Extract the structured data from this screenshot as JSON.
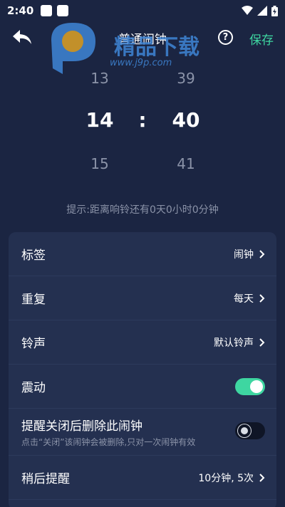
{
  "status_bar": {
    "time": "2:40"
  },
  "header": {
    "title": "普通闹钟",
    "help_label": "?",
    "save_label": "保存"
  },
  "watermark": {
    "text": "精品下载",
    "url": "www.j9p.com"
  },
  "picker": {
    "hours": [
      "13",
      "14",
      "15"
    ],
    "minutes": [
      "39",
      "40",
      "41"
    ],
    "separator": ":"
  },
  "hint": "提示:距离响铃还有0天0小时0分钟",
  "settings": {
    "label": {
      "title": "标签",
      "value": "闹钟"
    },
    "repeat": {
      "title": "重复",
      "value": "每天"
    },
    "ringtone": {
      "title": "铃声",
      "value": "默认铃声"
    },
    "vibrate": {
      "title": "震动",
      "enabled": true
    },
    "delete_after": {
      "title": "提醒关闭后删除此闹钟",
      "subtitle": "点击“关闭”该闹钟会被删除,只对一次闹钟有效",
      "enabled": false
    },
    "snooze": {
      "title": "稍后提醒",
      "value": "10分钟, 5次"
    }
  },
  "colors": {
    "background": "#1b2542",
    "card": "#243050",
    "accent": "#3ed6a1",
    "muted": "#8b93a8"
  }
}
